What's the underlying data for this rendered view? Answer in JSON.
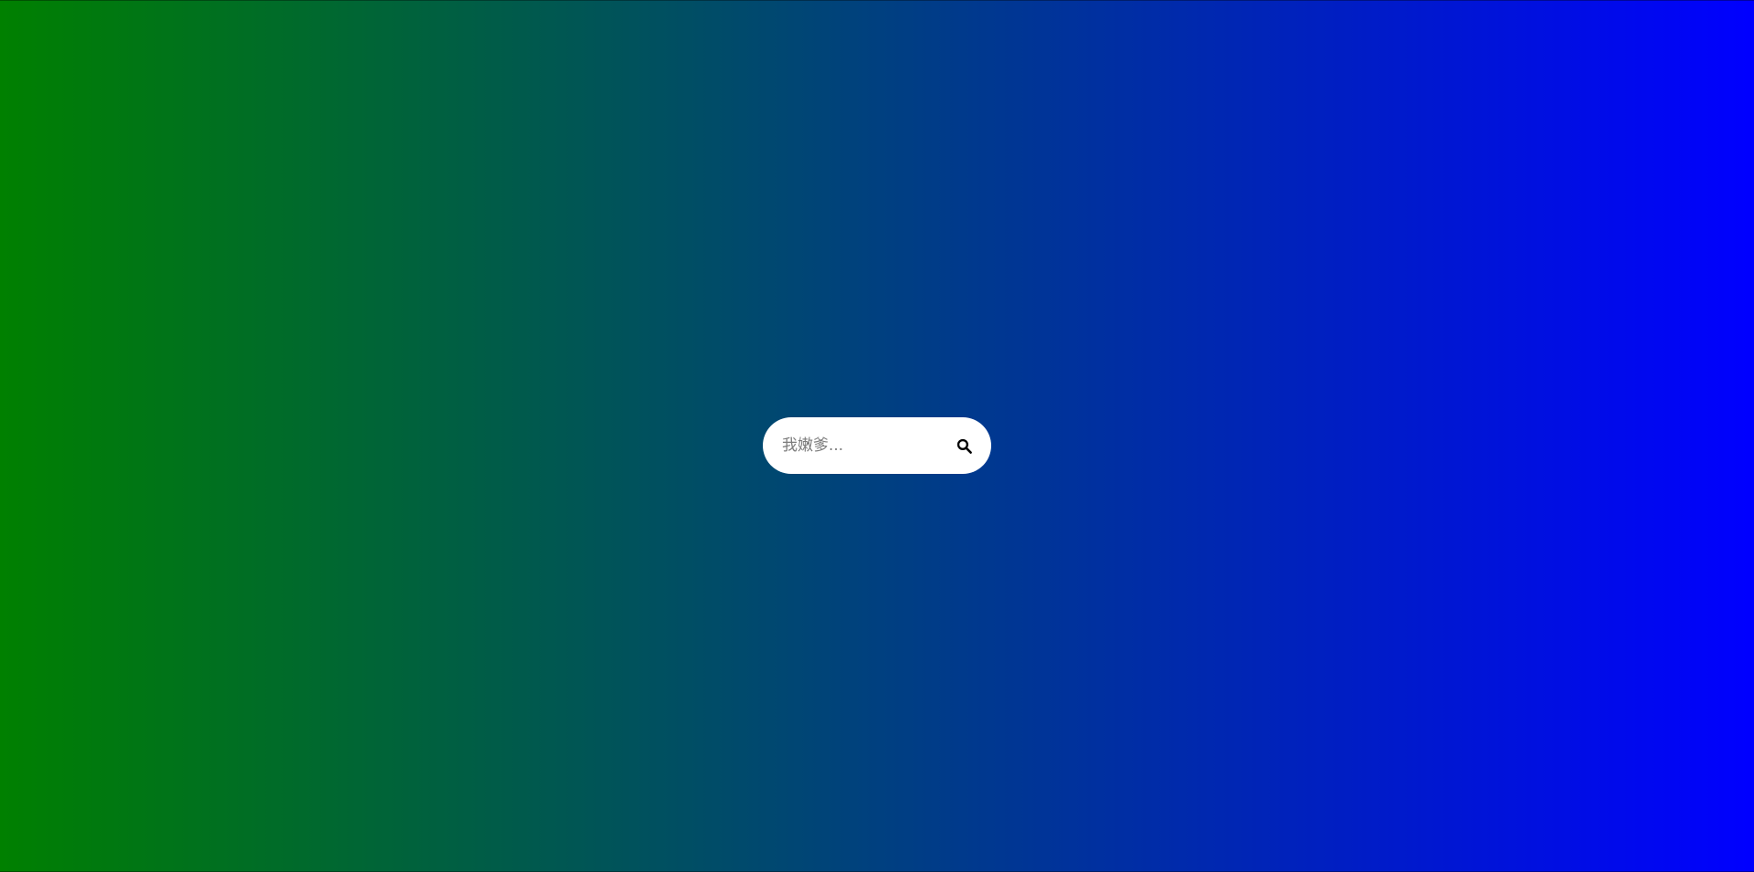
{
  "search": {
    "placeholder": "我嫩爹...",
    "value": "",
    "button_icon": "search-icon"
  },
  "background": {
    "gradient_start": "#008000",
    "gradient_end": "#0000ff"
  }
}
